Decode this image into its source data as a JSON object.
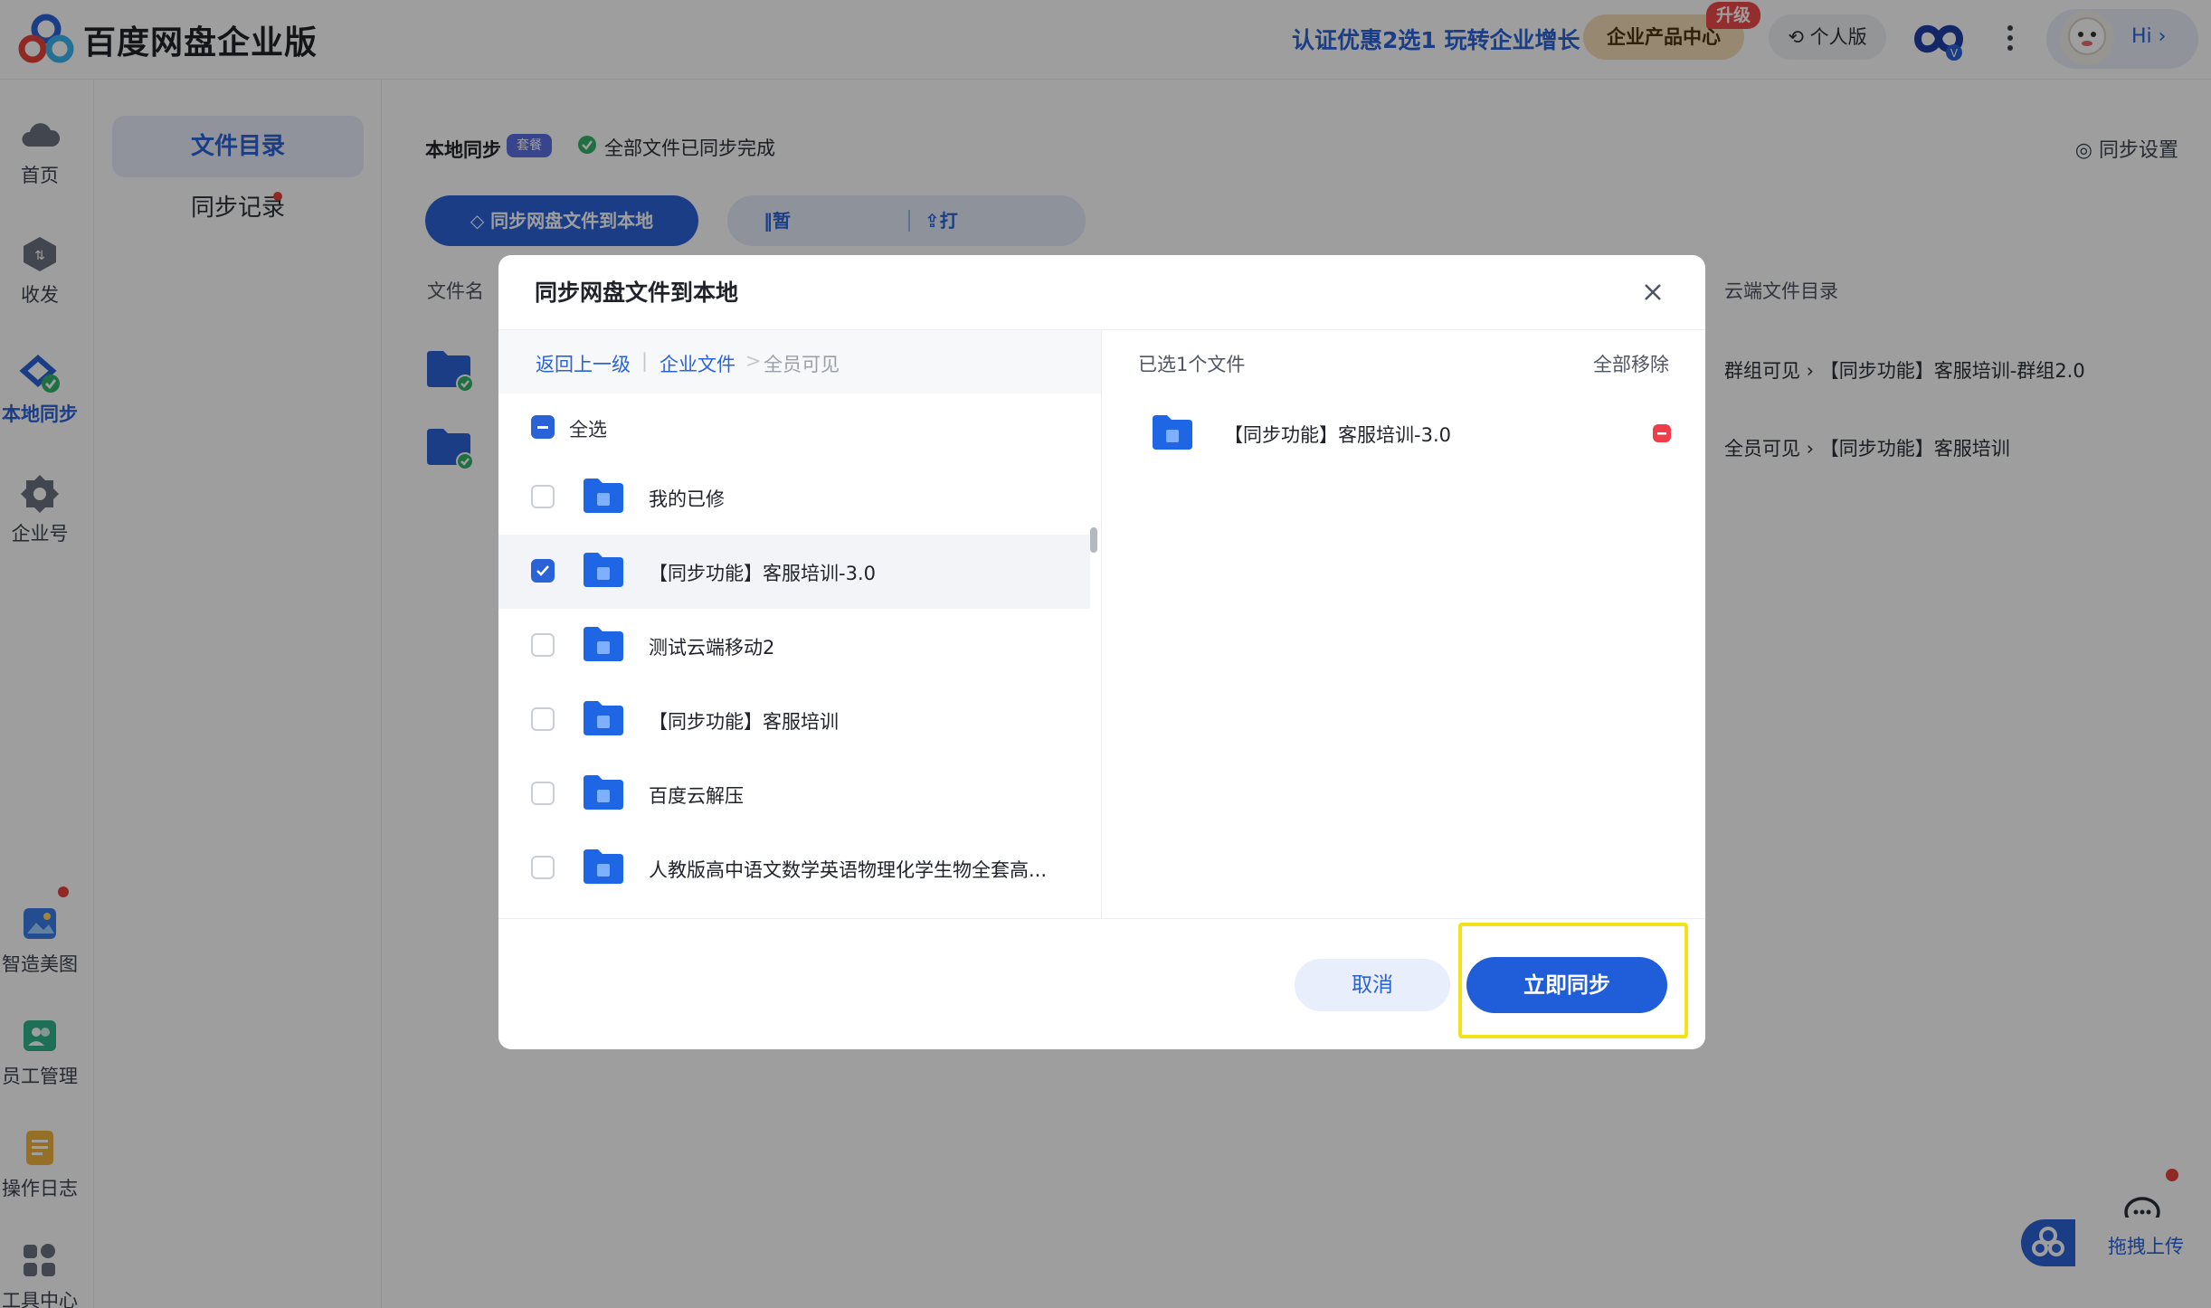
{
  "app": {
    "title": "百度网盘企业版",
    "promo": "认证优惠2选1 玩转企业增长",
    "product_center": "企业产品中心",
    "upgrade_badge": "升级",
    "personal": "个人版",
    "hi": "Hi ›"
  },
  "leftnav": {
    "items": [
      {
        "label": "首页",
        "icon": "cloud-icon"
      },
      {
        "label": "收发",
        "icon": "exchange-icon"
      },
      {
        "label": "本地同步",
        "icon": "sync-icon"
      },
      {
        "label": "企业号",
        "icon": "enterprise-icon"
      },
      {
        "label": "智造美图",
        "icon": "image-icon"
      },
      {
        "label": "员工管理",
        "icon": "staff-icon"
      },
      {
        "label": "操作日志",
        "icon": "log-icon"
      },
      {
        "label": "工具中心",
        "icon": "tools-icon"
      }
    ]
  },
  "subnav": {
    "items": [
      {
        "label": "文件目录"
      },
      {
        "label": "同步记录"
      }
    ]
  },
  "main": {
    "title": "本地同步",
    "plan_tag": "套餐",
    "status": "全部文件已同步完成",
    "settings": "同步设置",
    "btn_sync_to_local": "同步网盘文件到本地",
    "btn_pause": "暂停同步",
    "btn_open_local": "打开本地目录",
    "col_filename": "文件名",
    "col_cloud_dir": "云端文件目录",
    "rows": [
      {
        "path": "群组可见  ›  【同步功能】客服培训-群组2.0"
      },
      {
        "path": "全员可见  ›  【同步功能】客服培训"
      }
    ]
  },
  "dialog": {
    "title": "同步网盘文件到本地",
    "breadcrumb": {
      "back": "返回上一级",
      "sep": "|",
      "parent": "企业文件",
      "arrow": ">",
      "current": "全员可见"
    },
    "select_all": "全选",
    "items": [
      {
        "name": "我的已修",
        "checked": false
      },
      {
        "name": "【同步功能】客服培训-3.0",
        "checked": true
      },
      {
        "name": "测试云端移动2",
        "checked": false
      },
      {
        "name": "【同步功能】客服培训",
        "checked": false
      },
      {
        "name": "百度云解压",
        "checked": false
      },
      {
        "name": "人教版高中语文数学英语物理化学生物全套高...",
        "checked": false
      }
    ],
    "selected_count": "已选1个文件",
    "remove_all": "全部移除",
    "selected": [
      {
        "name": "【同步功能】客服培训-3.0"
      }
    ],
    "cancel": "取消",
    "confirm": "立即同步"
  },
  "floating": {
    "upload": "拖拽上传"
  },
  "colors": {
    "accent": "#2a63d8",
    "highlight": "#f2e21c"
  }
}
